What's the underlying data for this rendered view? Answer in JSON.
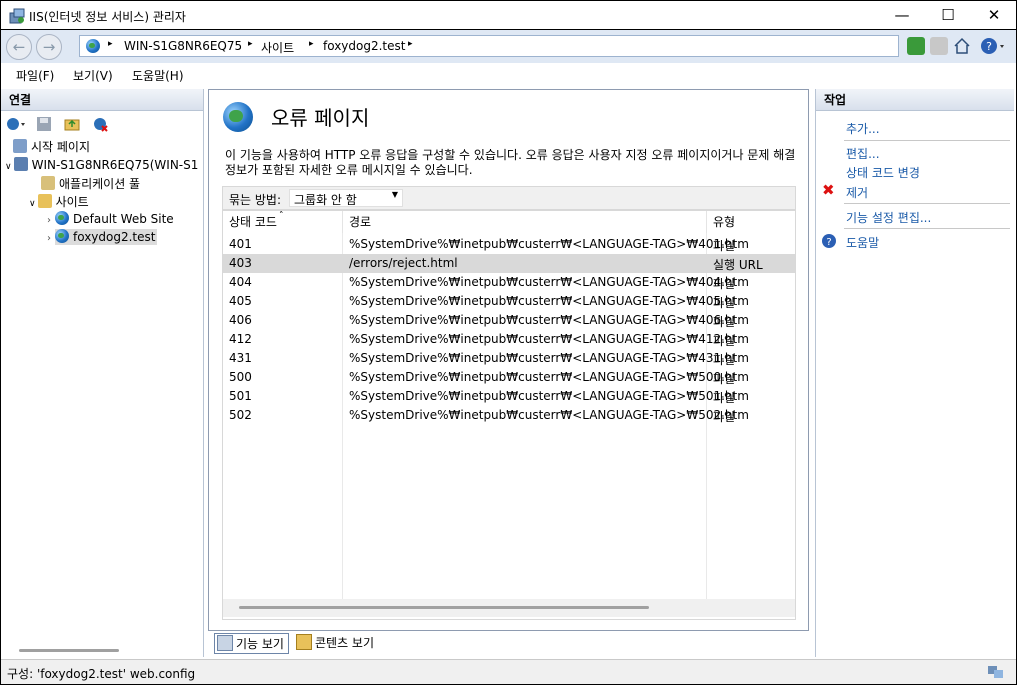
{
  "window": {
    "title": "IIS(인터넷 정보 서비스) 관리자",
    "minimize": "—",
    "maximize": "☐",
    "close": "✕"
  },
  "address": {
    "crumbs": [
      "WIN-S1G8NR6EQ75",
      "사이트",
      "foxydog2.test"
    ],
    "separator": "▸"
  },
  "menu": [
    "파일(F)",
    "보기(V)",
    "도움말(H)"
  ],
  "connections": {
    "header": "연결",
    "tree": [
      {
        "label": "시작 페이지",
        "icon": "start-page-icon"
      },
      {
        "label": "WIN-S1G8NR6EQ75(WIN-S1",
        "icon": "server-icon"
      },
      {
        "label": "애플리케이션 풀",
        "icon": "app-pool-icon"
      },
      {
        "label": "사이트",
        "icon": "sites-folder-icon"
      },
      {
        "label": "Default Web Site",
        "icon": "globe-icon"
      },
      {
        "label": "foxydog2.test",
        "icon": "globe-icon"
      }
    ]
  },
  "main": {
    "title": "오류 페이지",
    "description": "이 기능을 사용하여 HTTP 오류 응답을 구성할 수 있습니다. 오류 응답은 사용자 지정 오류 페이지이거나 문제 해결 정보가 포함된 자세한 오류 메시지일 수 있습니다.",
    "group_label": "묶는 방법:",
    "group_value": "그룹화 안 함",
    "columns": [
      "상태 코드",
      "경로",
      "유형"
    ],
    "rows": [
      {
        "code": "401",
        "path": "%SystemDrive%₩inetpub₩custerr₩<LANGUAGE-TAG>₩401.htm",
        "type": "파일"
      },
      {
        "code": "403",
        "path": "/errors/reject.html",
        "type": "실행 URL"
      },
      {
        "code": "404",
        "path": "%SystemDrive%₩inetpub₩custerr₩<LANGUAGE-TAG>₩404.htm",
        "type": "파일"
      },
      {
        "code": "405",
        "path": "%SystemDrive%₩inetpub₩custerr₩<LANGUAGE-TAG>₩405.htm",
        "type": "파일"
      },
      {
        "code": "406",
        "path": "%SystemDrive%₩inetpub₩custerr₩<LANGUAGE-TAG>₩406.htm",
        "type": "파일"
      },
      {
        "code": "412",
        "path": "%SystemDrive%₩inetpub₩custerr₩<LANGUAGE-TAG>₩412.htm",
        "type": "파일"
      },
      {
        "code": "431",
        "path": "%SystemDrive%₩inetpub₩custerr₩<LANGUAGE-TAG>₩431.htm",
        "type": "파일"
      },
      {
        "code": "500",
        "path": "%SystemDrive%₩inetpub₩custerr₩<LANGUAGE-TAG>₩500.htm",
        "type": "파일"
      },
      {
        "code": "501",
        "path": "%SystemDrive%₩inetpub₩custerr₩<LANGUAGE-TAG>₩501.htm",
        "type": "파일"
      },
      {
        "code": "502",
        "path": "%SystemDrive%₩inetpub₩custerr₩<LANGUAGE-TAG>₩502.htm",
        "type": "파일"
      }
    ],
    "selected_row": "403"
  },
  "views": {
    "features": "기능 보기",
    "content": "콘텐츠 보기"
  },
  "actions": {
    "header": "작업",
    "add": "추가...",
    "edit": "편집...",
    "change_status_code": "상태 코드 변경",
    "remove": "제거",
    "edit_feature_settings": "기능 설정 편집...",
    "help": "도움말"
  },
  "status": {
    "text": "구성: 'foxydog2.test' web.config"
  },
  "colors": {
    "accent": "#1a5aa8",
    "selected_row": "#d9d9d9",
    "address_bar": "#dfe8f4"
  }
}
